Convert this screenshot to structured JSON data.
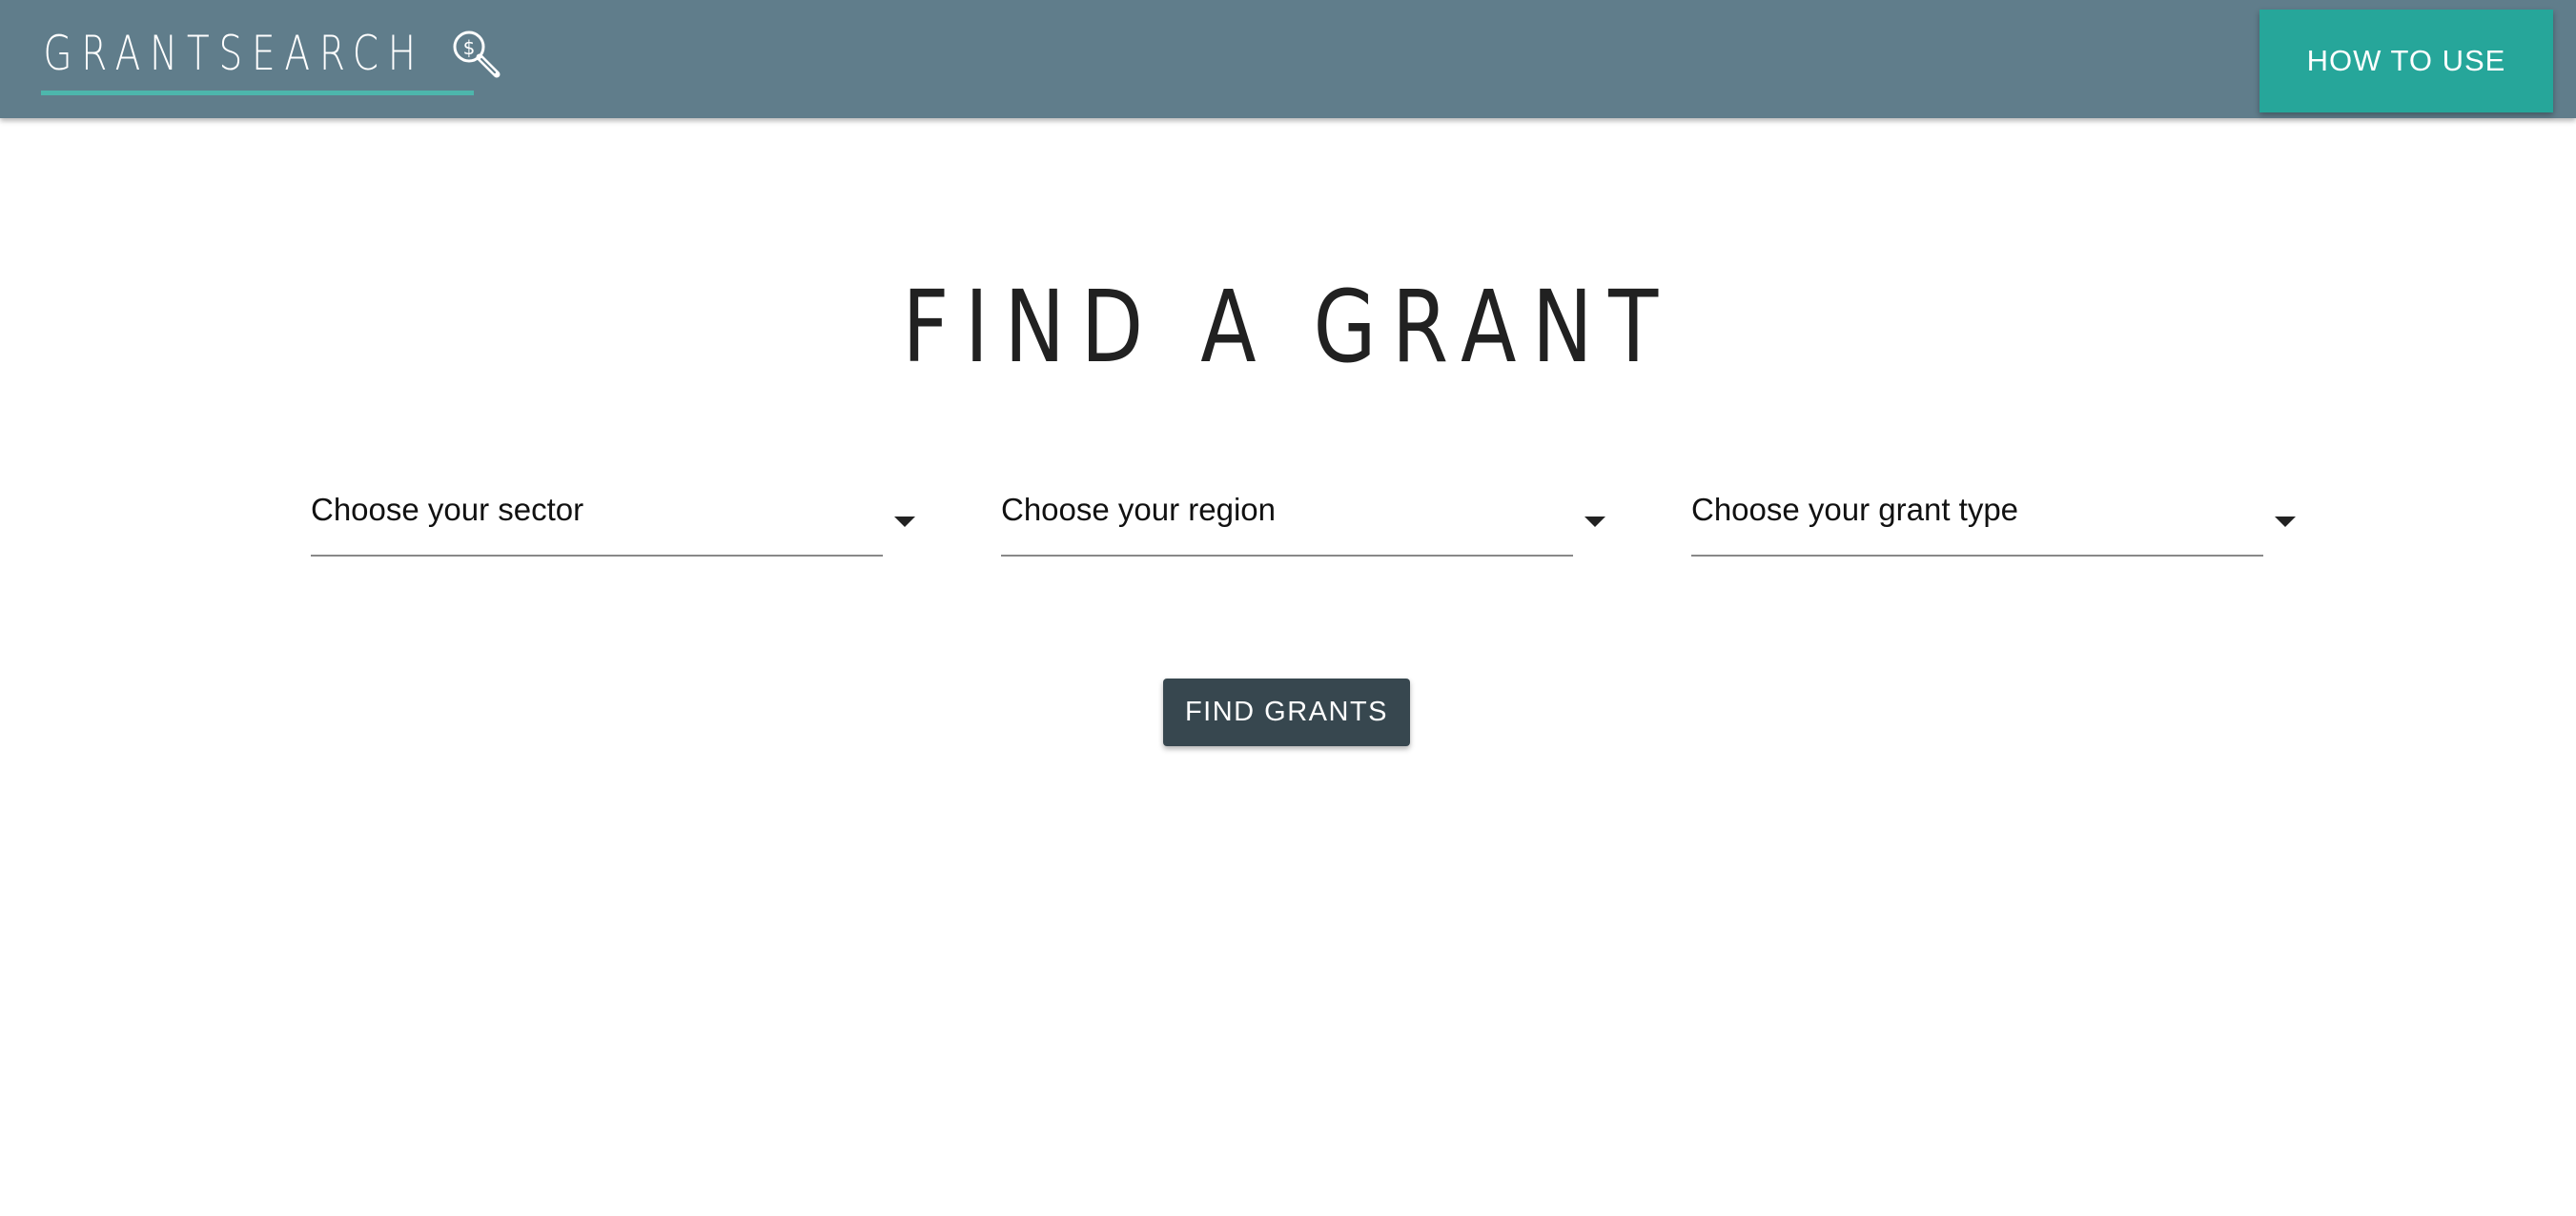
{
  "header": {
    "logo_text": "GRANTSEARCH",
    "logo_icon": "magnifier-dollar-icon",
    "how_to_use_label": "HOW TO USE"
  },
  "main": {
    "title": "FIND A GRANT",
    "selects": {
      "sector": {
        "placeholder": "Choose your sector"
      },
      "region": {
        "placeholder": "Choose your region"
      },
      "grant_type": {
        "placeholder": "Choose your grant type"
      }
    },
    "find_grants_label": "FIND GRANTS"
  },
  "colors": {
    "app_bar": "#607d8b",
    "accent": "#26a69a",
    "logo_underline": "#4db6ac",
    "primary_button": "#37474f",
    "title_text": "#212121"
  }
}
